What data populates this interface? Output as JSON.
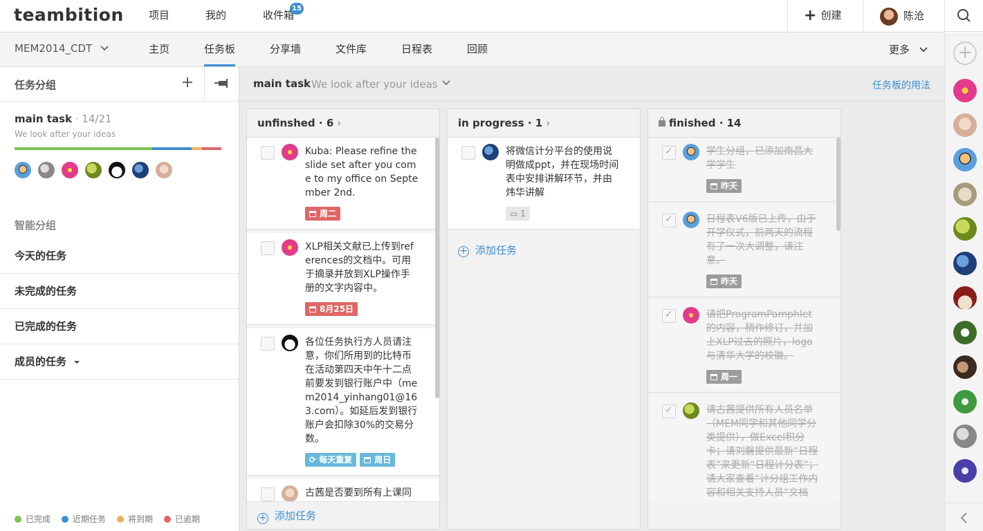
{
  "app": {
    "logo": "teambition",
    "nav": [
      "项目",
      "我的",
      "收件箱"
    ],
    "inbox_badge": "15",
    "create_label": "创建",
    "user_name": "陈沧",
    "icons": [
      "plus-icon",
      "search-icon",
      "chevron-down-icon",
      "pin-icon",
      "calendar-icon",
      "repeat-icon",
      "comment-icon",
      "lock-icon",
      "chevron-left-icon"
    ]
  },
  "subnav": {
    "project": "MEM2014_CDT",
    "tabs": [
      "主页",
      "任务板",
      "分享墙",
      "文件库",
      "日程表",
      "回顾"
    ],
    "active_tab": "任务板",
    "more": "更多"
  },
  "left": {
    "title": "任务分组",
    "group": {
      "name": "main task",
      "count": " · 14/21",
      "desc": "We look after your ideas",
      "progress": {
        "done": 0.667,
        "upcoming": 0.19,
        "due_soon": 0.048,
        "overdue": 0.095
      }
    },
    "smart_title": "智能分组",
    "smart_items": [
      "今天的任务",
      "未完成的任务",
      "已完成的任务",
      "成员的任务"
    ],
    "legend": [
      "已完成",
      "近期任务",
      "将到期",
      "已逾期"
    ],
    "colors": {
      "done": "#7ec352",
      "upcoming": "#3d8fd1",
      "due_soon": "#f0b05a",
      "overdue": "#e06666"
    }
  },
  "board": {
    "title": "main task",
    "subtitle": "We look after your ideas",
    "help": "任务板的用法",
    "add_task": "添加任务",
    "columns": [
      {
        "name": "unfinshed",
        "count": " · 6",
        "cards": [
          {
            "text": "Kuba: Please refine the slide set after you come to my office on September 2nd.",
            "tags": [
              "周二"
            ]
          },
          {
            "text": "XLP相关文献已上传到references的文档中。可用于摘录并放到XLP操作手册的文字内容中。",
            "tags": [
              "8月25日"
            ]
          },
          {
            "text": "各位任务执行方人员请注意，你们所用到的比特币在活动第四天中午十二点前要发到银行账户中（mem2014_yinhang01@163.com）。如延后发到银行账户会扣除30%的交易分数。",
            "tags": [
              "每天重复",
              "周日"
            ]
          },
          {
            "text": "古茜是否要到所有上课同",
            "tags": []
          }
        ]
      },
      {
        "name": "in progress",
        "count": " · 1",
        "cards": [
          {
            "text": "将微信计分平台的使用说明做成ppt，并在现场时间表中安排讲解环节，并由炜华讲解",
            "tags": [
              "1"
            ]
          }
        ]
      },
      {
        "name": "finished",
        "count": " · 14",
        "cards": [
          {
            "text": "学生分组，已添加南昌大学学生",
            "tags": [
              "昨天"
            ]
          },
          {
            "text": "日程表V6版已上传，由于开学仪式，前两天的流程有了一次大调整，请注意。",
            "tags": [
              "昨天"
            ]
          },
          {
            "text": "请把ProgramPamphlet的内容，稍作修订，并加上XLP过去的照片，logo与清华大学的校徽。",
            "tags": [
              "周一"
            ]
          },
          {
            "text": "请古茜提供所有人员名单（MEM同学和其他同学分类提供），做Excel积分卡；请刘磐提供最新“日程表”来更新“日程计分表”；请大家查看“计分组工作内容和相关支持人员”文档",
            "tags": []
          }
        ]
      }
    ]
  }
}
